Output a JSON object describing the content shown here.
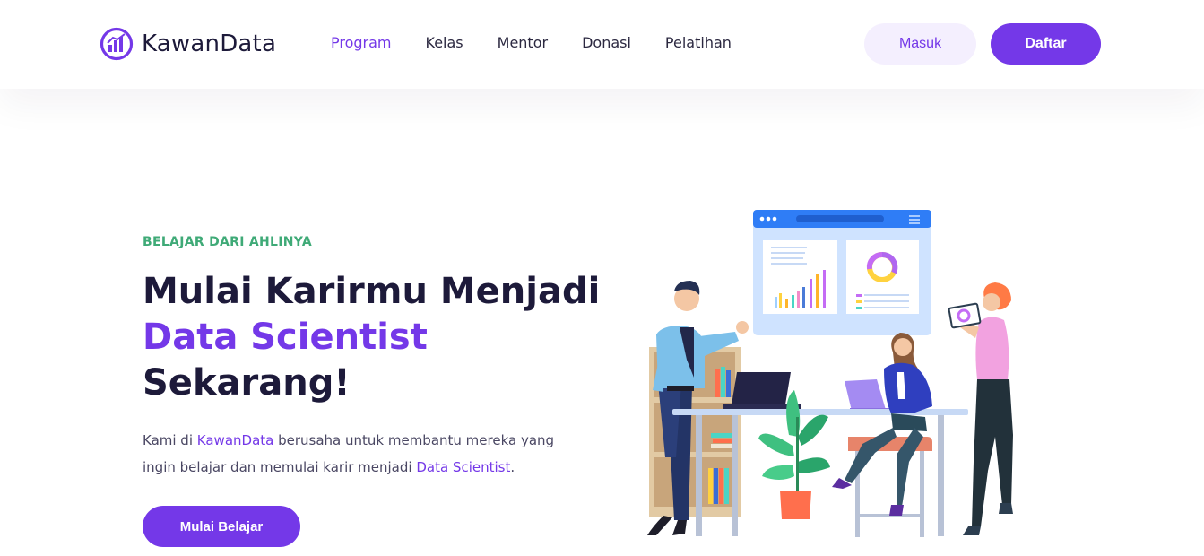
{
  "brand": {
    "name": "KawanData",
    "accent": "#7438e8",
    "logo_icon": "bar-chart-circle-icon"
  },
  "nav": {
    "items": [
      {
        "label": "Program",
        "active": true
      },
      {
        "label": "Kelas",
        "active": false
      },
      {
        "label": "Mentor",
        "active": false
      },
      {
        "label": "Donasi",
        "active": false
      },
      {
        "label": "Pelatihan",
        "active": false
      }
    ]
  },
  "auth": {
    "login_label": "Masuk",
    "register_label": "Daftar"
  },
  "hero": {
    "eyebrow": "BELAJAR DARI AHLINYA",
    "headline_line1": "Mulai Karirmu Menjadi",
    "headline_accent": "Data Scientist",
    "headline_line3": "Sekarang!",
    "desc_part1": "Kami di ",
    "desc_brand": "KawanData",
    "desc_part2": " berusaha untuk membantu mereka yang ingin belajar dan memulai karir menjadi ",
    "desc_role": "Data Scientist",
    "desc_end": ".",
    "cta_label": "Mulai Belajar"
  },
  "colors": {
    "eyebrow": "#3faa77",
    "text": "#1d1a3a",
    "masuk_bg": "#f4effe"
  }
}
